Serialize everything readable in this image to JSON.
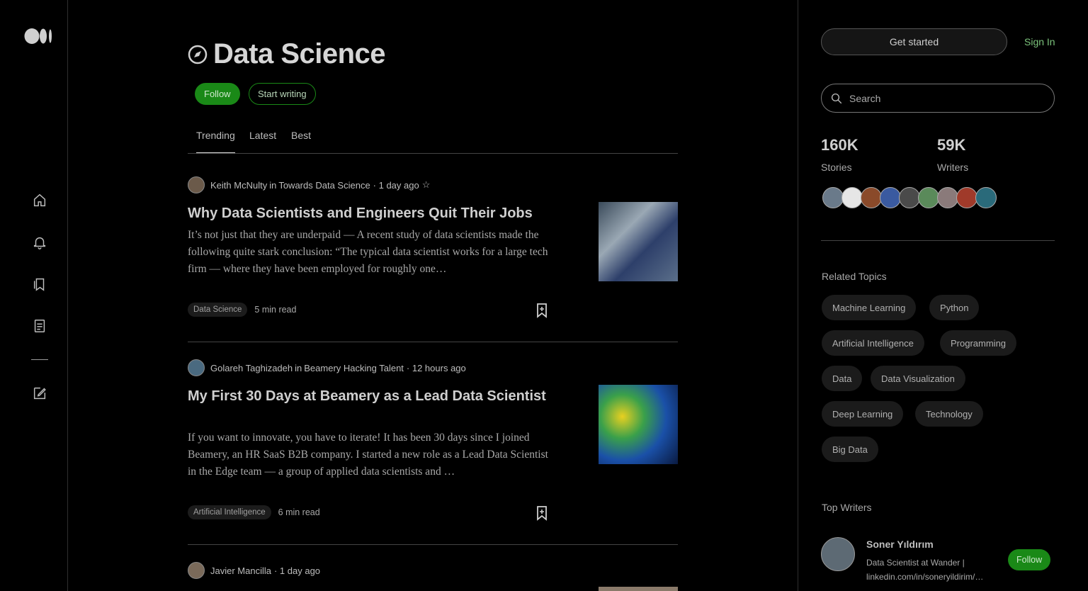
{
  "brand": {
    "logo_icon": "medium-logo-icon"
  },
  "rail": {
    "icons": [
      "home-icon",
      "bell-icon",
      "bookmarks-icon",
      "stories-icon",
      "write-icon"
    ]
  },
  "topic": {
    "title": "Data Science",
    "follow_label": "Follow",
    "write_label": "Start writing",
    "tabs": [
      {
        "label": "Trending",
        "active": true
      },
      {
        "label": "Latest",
        "active": false
      },
      {
        "label": "Best",
        "active": false
      }
    ]
  },
  "posts": [
    {
      "author": "Keith McNulty",
      "in": "in",
      "publication": "Towards Data Science",
      "time": "· 1 day ago",
      "star": "☆",
      "title": "Why Data Scientists and Engineers Quit Their Jobs",
      "excerpt": "It’s not just that they are underpaid — A recent study of data scientists made the following quite stark conclusion: “The typical data scientist works for a large tech firm — where they have been employed for roughly one…",
      "tag": "Data Science",
      "read": "5 min read"
    },
    {
      "author": "Golareh Taghizadeh",
      "in": "in",
      "publication": "Beamery Hacking Talent",
      "time": "· 12 hours ago",
      "star": "",
      "title": "My First 30 Days at Beamery as a Lead Data Scientist",
      "excerpt": "If you want to innovate, you have to iterate! It has been 30 days since I joined Beamery, an HR SaaS B2B company. I started a new role as a Lead Data Scientist in the Edge team — a group of applied data scientists and …",
      "tag": "Artificial Intelligence",
      "read": "6 min read"
    },
    {
      "author": "Javier Mancilla",
      "in": "",
      "publication": "",
      "time": "· 1 day ago",
      "star": ""
    }
  ],
  "sidebar": {
    "get_started": "Get started",
    "sign_in": "Sign In",
    "search_placeholder": "Search",
    "stories_count": "160K",
    "stories_label": "Stories",
    "writers_count": "59K",
    "writers_label": "Writers",
    "related_heading": "Related Topics",
    "related": [
      "Machine Learning",
      "Python",
      "Artificial Intelligence",
      "Programming",
      "Data",
      "Data Visualization",
      "Deep Learning",
      "Technology",
      "Big Data"
    ],
    "top_writers_heading": "Top Writers",
    "writer": {
      "name": "Soner Yıldırım",
      "bio": "Data Scientist at Wander | linkedin.com/in/soneryildirim/…",
      "follow_label": "Follow"
    }
  },
  "colors": {
    "accent": "#1a8917",
    "background": "#000000"
  }
}
